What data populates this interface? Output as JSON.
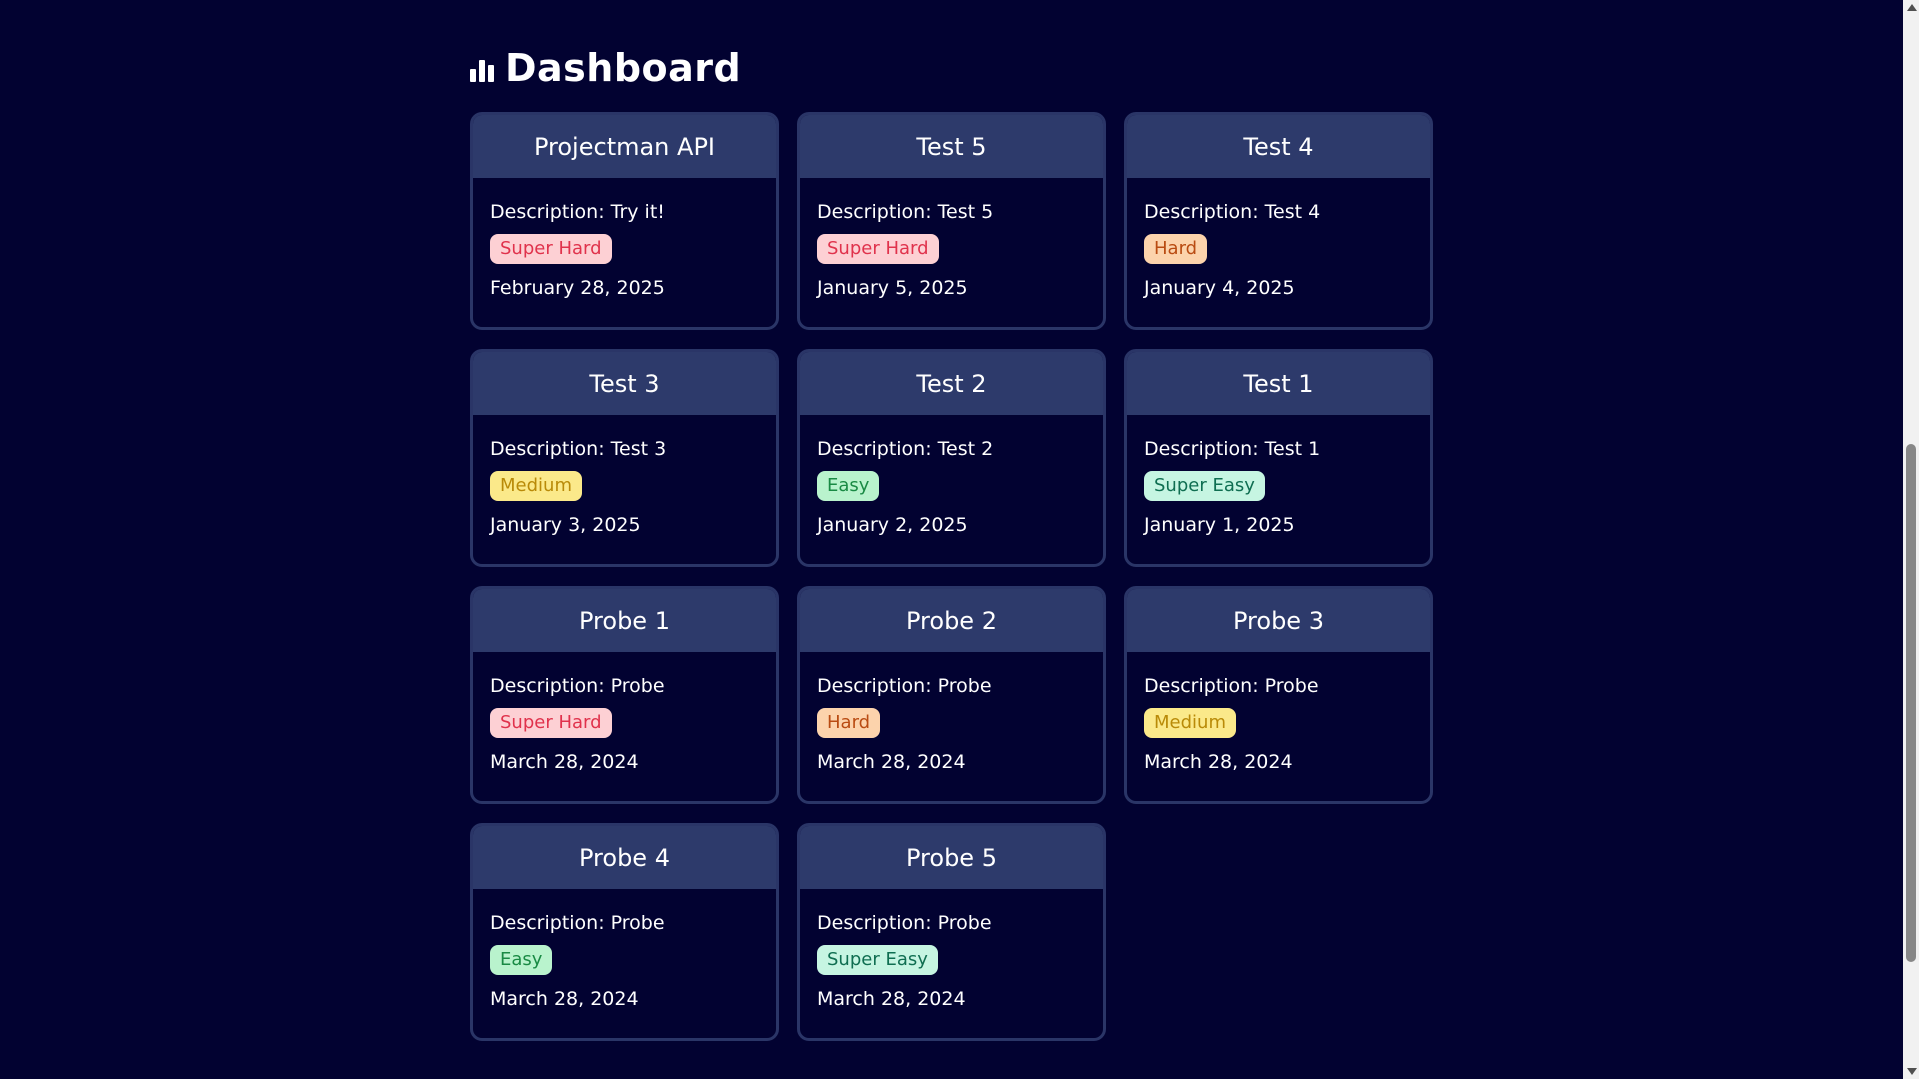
{
  "page": {
    "title": "Dashboard",
    "icon": "bar-chart-icon"
  },
  "projects": [
    {
      "title": "Projectman API",
      "description": "Description: Try it!",
      "difficulty": "Super Hard",
      "difficulty_key": "super-hard",
      "date": "February 28, 2025"
    },
    {
      "title": "Test 5",
      "description": "Description: Test 5",
      "difficulty": "Super Hard",
      "difficulty_key": "super-hard",
      "date": "January 5, 2025"
    },
    {
      "title": "Test 4",
      "description": "Description: Test 4",
      "difficulty": "Hard",
      "difficulty_key": "hard",
      "date": "January 4, 2025"
    },
    {
      "title": "Test 3",
      "description": "Description: Test 3",
      "difficulty": "Medium",
      "difficulty_key": "medium",
      "date": "January 3, 2025"
    },
    {
      "title": "Test 2",
      "description": "Description: Test 2",
      "difficulty": "Easy",
      "difficulty_key": "easy",
      "date": "January 2, 2025"
    },
    {
      "title": "Test 1",
      "description": "Description: Test 1",
      "difficulty": "Super Easy",
      "difficulty_key": "super-easy",
      "date": "January 1, 2025"
    },
    {
      "title": "Probe 1",
      "description": "Description: Probe",
      "difficulty": "Super Hard",
      "difficulty_key": "super-hard",
      "date": "March 28, 2024"
    },
    {
      "title": "Probe 2",
      "description": "Description: Probe",
      "difficulty": "Hard",
      "difficulty_key": "hard",
      "date": "March 28, 2024"
    },
    {
      "title": "Probe 3",
      "description": "Description: Probe",
      "difficulty": "Medium",
      "difficulty_key": "medium",
      "date": "March 28, 2024"
    },
    {
      "title": "Probe 4",
      "description": "Description: Probe",
      "difficulty": "Easy",
      "difficulty_key": "easy",
      "date": "March 28, 2024"
    },
    {
      "title": "Probe 5",
      "description": "Description: Probe",
      "difficulty": "Super Easy",
      "difficulty_key": "super-easy",
      "date": "March 28, 2024"
    }
  ],
  "colors": {
    "background": "#020231",
    "card_header": "#2d3a6b",
    "card_border": "#2a3567",
    "super_hard_bg": "#fdd0d4",
    "hard_bg": "#fcd3ac",
    "medium_bg": "#fbe98a",
    "easy_bg": "#b9f3cd",
    "super_easy_bg": "#c6f5e2"
  }
}
